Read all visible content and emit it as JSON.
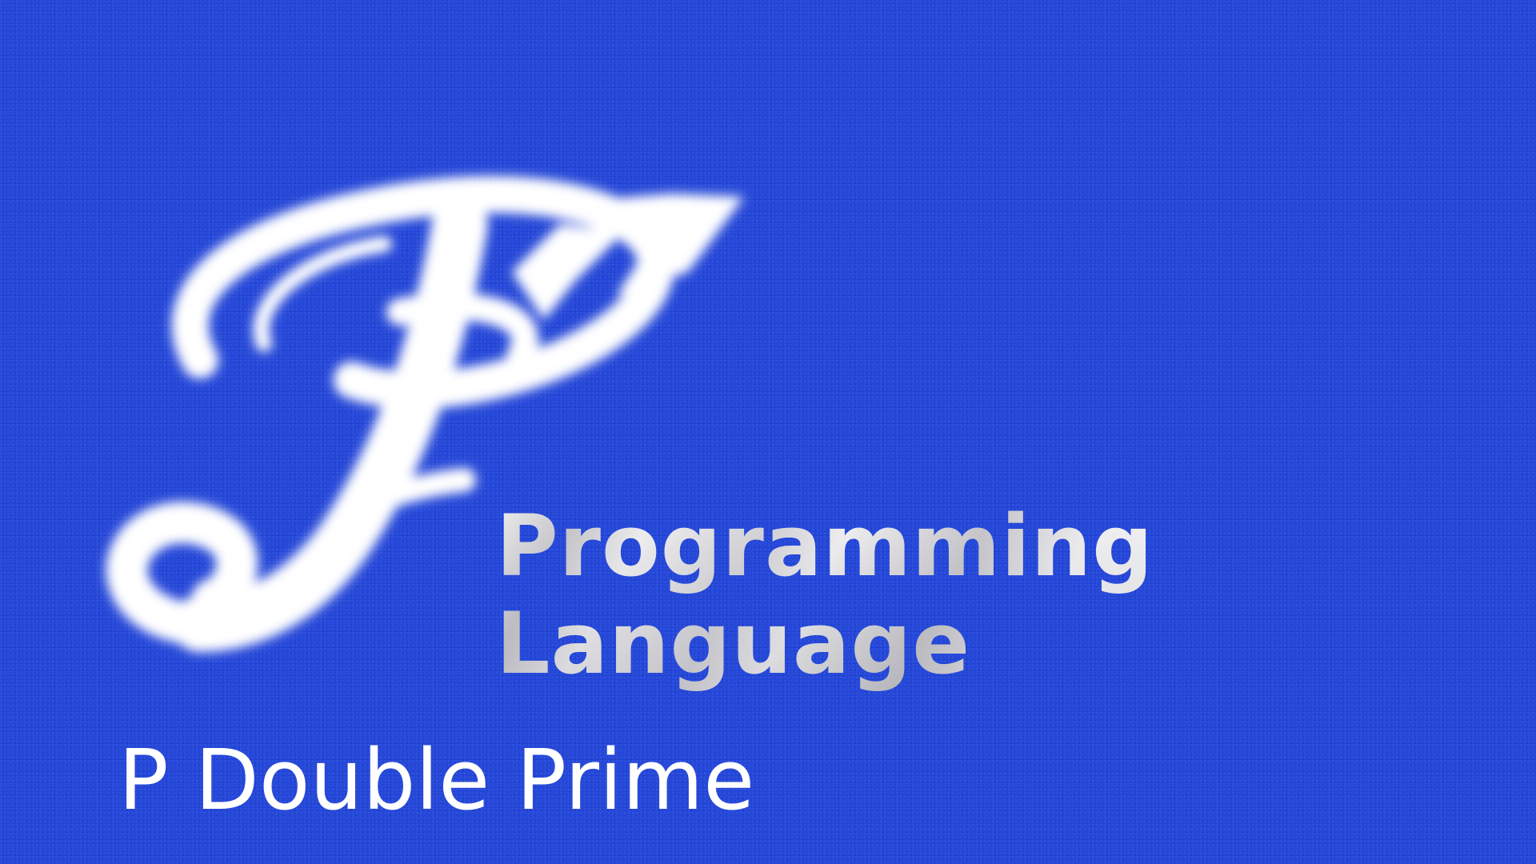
{
  "logo": {
    "icon": "p-double-prime-logo",
    "color": "#ffffff"
  },
  "subtitle": {
    "line1": "Programming",
    "line2": "Language"
  },
  "caption": "P Double Prime",
  "colors": {
    "background": "#2446d8",
    "logo": "#ffffff",
    "subtitle": "#e4e4e8"
  }
}
